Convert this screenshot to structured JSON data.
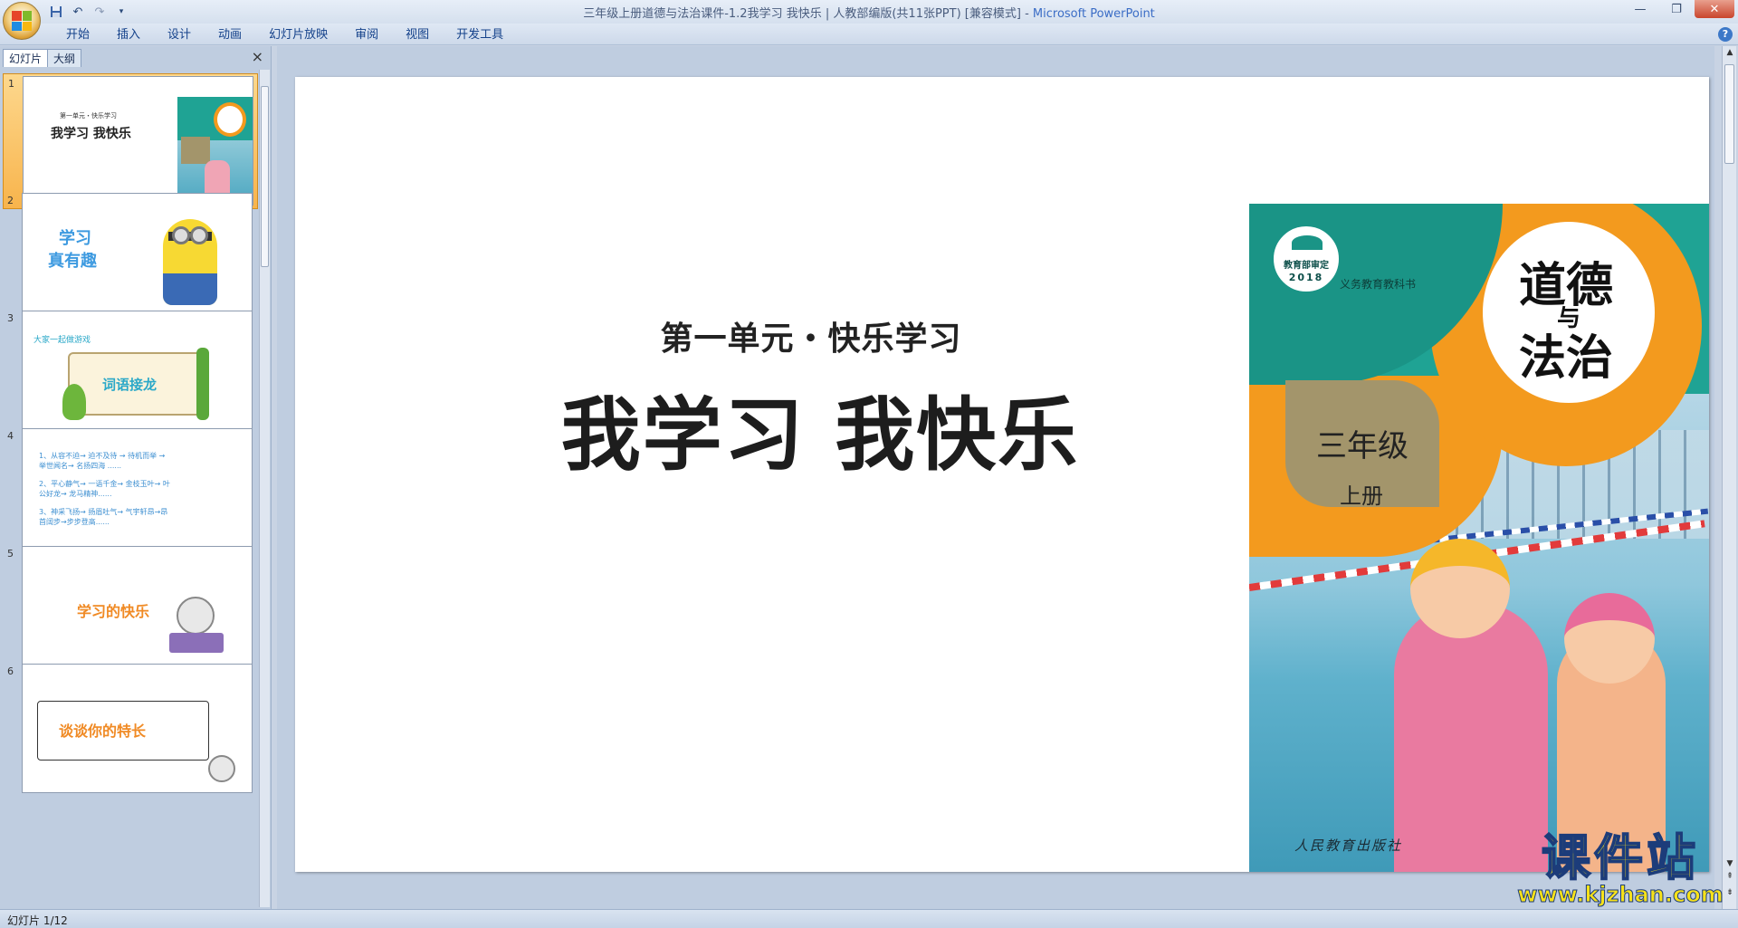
{
  "window": {
    "title": "三年级上册道德与法治课件-1.2我学习 我快乐 | 人教部编版(共11张PPT) [兼容模式]",
    "app_name": "Microsoft PowerPoint",
    "separator": " - "
  },
  "ribbon": {
    "tabs": [
      "开始",
      "插入",
      "设计",
      "动画",
      "幻灯片放映",
      "审阅",
      "视图",
      "开发工具"
    ]
  },
  "left_panel": {
    "tabs": [
      "幻灯片",
      "大纲"
    ],
    "close_label": "×",
    "slides": [
      {
        "number": "1",
        "subtitle": "第一单元・快乐学习",
        "title": "我学习 我快乐"
      },
      {
        "number": "2",
        "title_line1": "学习",
        "title_line2": "真有趣"
      },
      {
        "number": "3",
        "caption": "大家一起做游戏",
        "title": "词语接龙"
      },
      {
        "number": "4",
        "lines": [
          "1、从容不迫→ 迫不及待 → 待机而举 →",
          "举世闻名→ 名扬四海 ......",
          "2、平心静气→ 一语千金→ 金枝玉叶→ 叶",
          "公好龙→ 龙马精神......",
          "3、神采飞扬→ 扬眉吐气→ 气宇轩昂→昂",
          "首阔步→步步登高......"
        ]
      },
      {
        "number": "5",
        "title": "学习的快乐"
      },
      {
        "number": "6",
        "title": "谈谈你的特长"
      }
    ]
  },
  "slide": {
    "subtitle": "第一单元・快乐学习",
    "title": "我学习 我快乐",
    "book": {
      "badge_top": "教育部审定",
      "badge_year": "2018",
      "series": "义务教育教科书",
      "subject_line1": "道德",
      "subject_mid": "与",
      "subject_line2": "法治",
      "grade": "三年级",
      "volume": "上册",
      "publisher": "人民教育出版社"
    }
  },
  "status": {
    "slide_counter": "幻灯片 1/12"
  },
  "watermark": {
    "main": "课件站",
    "url": "www.kjzhan.com"
  },
  "colors": {
    "book_teal": "#1fa394",
    "book_orange": "#f39a1e",
    "book_khaki": "#a3956b",
    "thumb_active": "#f8b44c"
  }
}
